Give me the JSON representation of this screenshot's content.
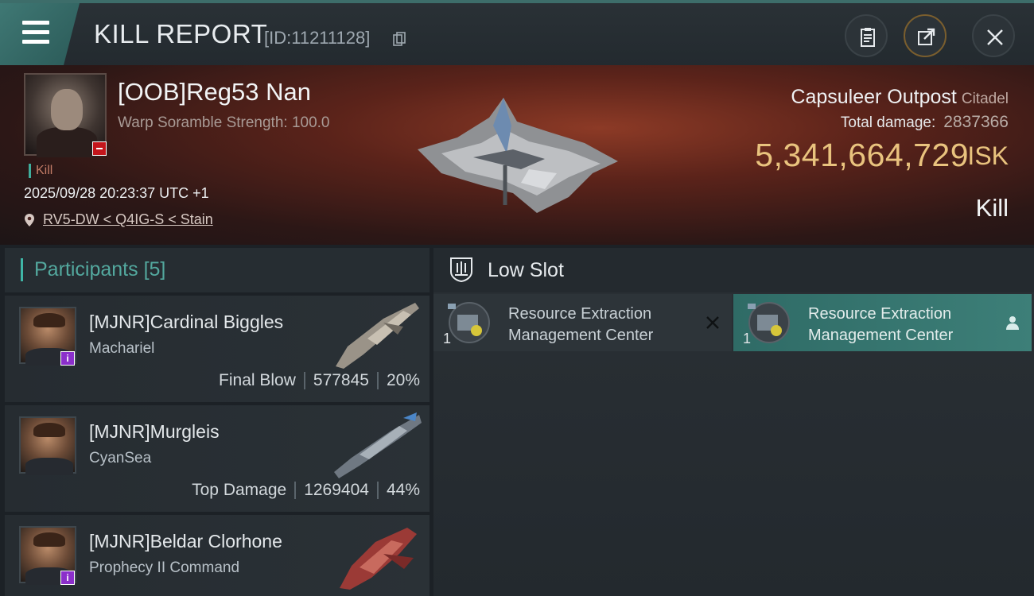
{
  "header": {
    "title": "KILL REPORT",
    "report_id": "[ID:11211128]",
    "icons": [
      "menu-icon",
      "copy-icon",
      "clipboard-icon",
      "share-icon",
      "close-icon"
    ]
  },
  "victim": {
    "name": "[OOB]Reg53 Nan",
    "scramble": "Warp Soramble Strength: 100.0",
    "kill_tag": "Kill",
    "datetime": "2025/09/28 20:23:37 UTC +1",
    "location": "RV5-DW < Q4IG-S < Stain",
    "ship_name": "Capsuleer Outpost",
    "ship_class": "Citadel",
    "total_damage_label": "Total damage:",
    "total_damage": "2837366",
    "isk_value": "5,341,664,729",
    "isk_unit": "ISK",
    "result": "Kill"
  },
  "participants": {
    "label": "Participants",
    "count": "[5]",
    "rows": [
      {
        "name": "[MJNR]Cardinal Biggles",
        "ship": "Machariel",
        "role": "Final Blow",
        "damage": "577845",
        "percent": "20%"
      },
      {
        "name": "[MJNR]Murgleis",
        "ship": "CyanSea",
        "role": "Top Damage",
        "damage": "1269404",
        "percent": "44%"
      },
      {
        "name": "[MJNR]Beldar Clorhone",
        "ship": "Prophecy II Command",
        "role": "",
        "damage": "",
        "percent": ""
      }
    ]
  },
  "slots": {
    "title": "Low Slot",
    "modules": [
      {
        "name_line1": "Resource Extraction",
        "name_line2": "Management Center",
        "qty": "1",
        "status": "destroyed"
      },
      {
        "name_line1": "Resource Extraction",
        "name_line2": "Management Center",
        "qty": "1",
        "status": "dropped"
      }
    ]
  },
  "colors": {
    "accent": "#3fb6a7",
    "isk": "#e9c37e",
    "selected_module": "#3d7f78"
  }
}
